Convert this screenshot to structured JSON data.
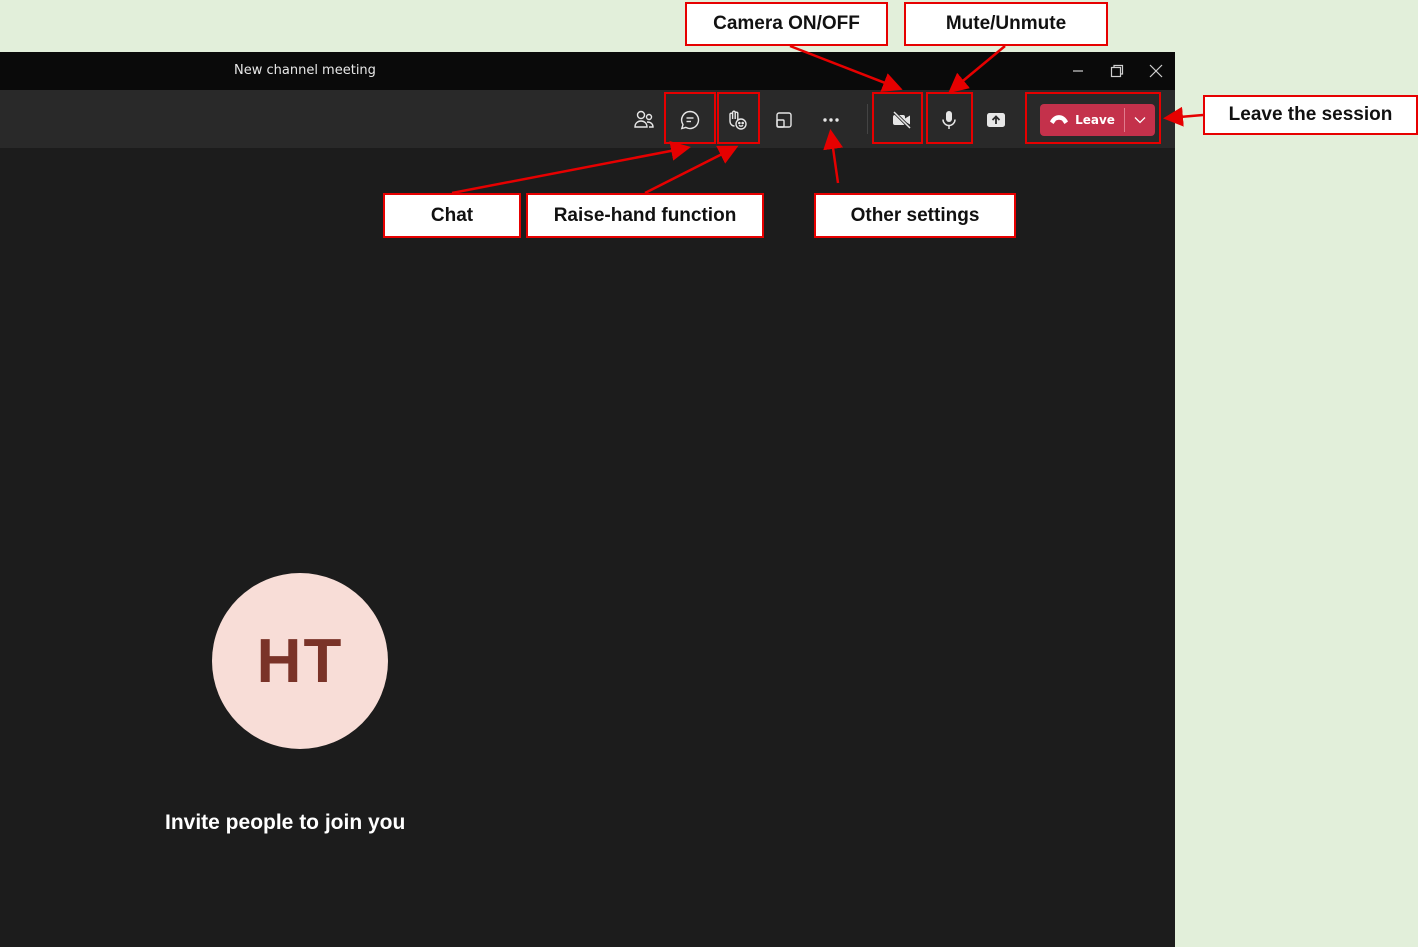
{
  "window": {
    "title": "New channel meeting"
  },
  "toolbar": {
    "buttons": [
      {
        "name": "participants",
        "icon": "people-icon"
      },
      {
        "name": "chat",
        "icon": "chat-icon"
      },
      {
        "name": "raise-hand",
        "icon": "raise-hand-icon"
      },
      {
        "name": "room-view",
        "icon": "room-view-icon"
      },
      {
        "name": "more",
        "icon": "more-icon"
      },
      {
        "name": "camera",
        "icon": "camera-off-icon"
      },
      {
        "name": "microphone",
        "icon": "microphone-icon"
      },
      {
        "name": "share",
        "icon": "share-icon"
      }
    ],
    "leave_label": "Leave",
    "leave_color": "#c4314b"
  },
  "stage": {
    "avatar_initials": "HT",
    "avatar_bg": "#f8ddd7",
    "invite_text": "Invite people to join you"
  },
  "annotations": {
    "camera": "Camera ON/OFF",
    "mute": "Mute/Unmute",
    "leave": "Leave the session",
    "chat": "Chat",
    "raise_hand": "Raise-hand function",
    "other": "Other settings",
    "color": "#e60000"
  }
}
